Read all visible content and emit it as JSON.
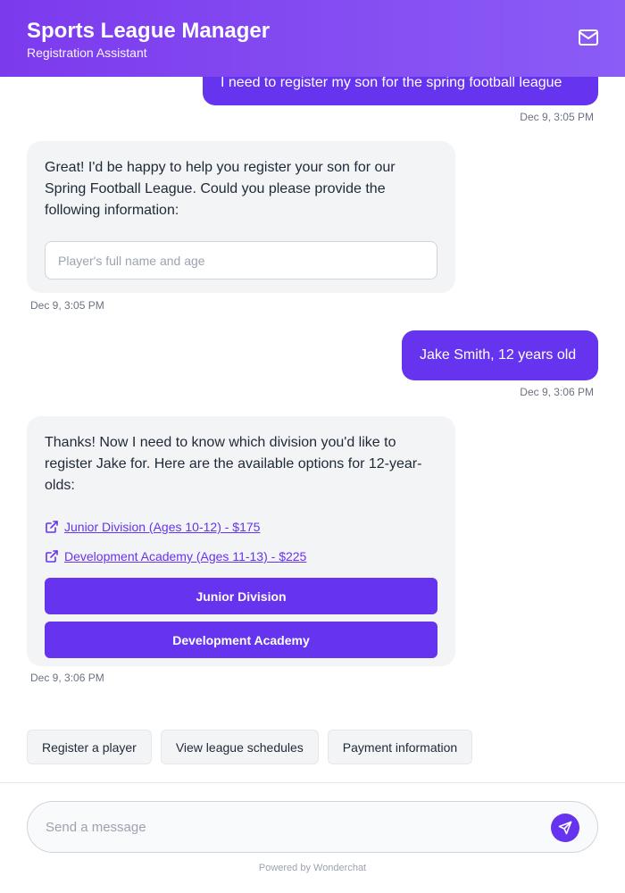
{
  "header": {
    "title": "Sports League Manager",
    "subtitle": "Registration Assistant",
    "mail_icon": "mail-icon"
  },
  "messages": [
    {
      "role": "user",
      "text": "I need to register my son for the spring football league",
      "time": "Dec 9, 3:05 PM"
    },
    {
      "role": "bot",
      "text": "Great! I'd be happy to help you register your son for our Spring Football League. Could you please provide the following information:",
      "field_placeholder": "Player's full name and age",
      "time": "Dec 9, 3:05 PM"
    },
    {
      "role": "user",
      "text": "Jake Smith, 12 years old",
      "time": "Dec 9, 3:06 PM"
    },
    {
      "role": "bot",
      "text": "Thanks! Now I need to know which division you'd like to register Jake for. Here are the available options for 12-year-olds:",
      "links": [
        "Junior Division (Ages 10-12) - $175",
        "Development Academy (Ages 11-13) - $225"
      ],
      "buttons": [
        "Junior Division",
        "Development Academy"
      ],
      "time": "Dec 9, 3:06 PM"
    }
  ],
  "quick_replies": [
    "Register a player",
    "View league schedules",
    "Payment information"
  ],
  "composer": {
    "placeholder": "Send a message"
  },
  "footer": {
    "powered_by": "Powered by Wonderchat"
  },
  "colors": {
    "accent": "#6633ee",
    "header_start": "#7c3aed",
    "header_end": "#8b5cf6",
    "bot_bubble": "#f3f4f6"
  }
}
